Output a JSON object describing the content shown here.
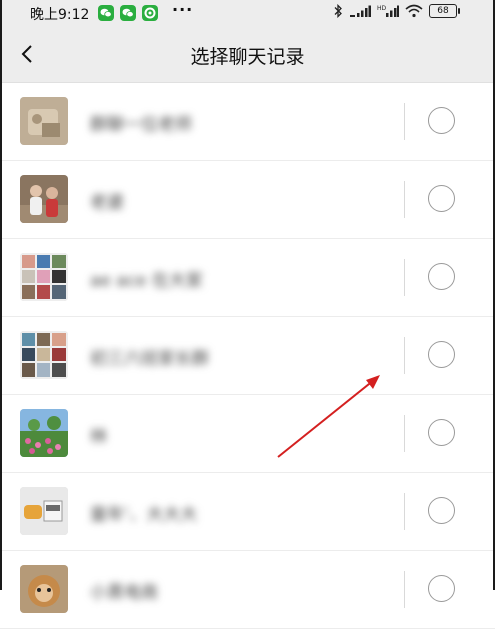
{
  "status_bar": {
    "time": "晚上9:12",
    "more": "···",
    "battery": "68"
  },
  "header": {
    "title": "选择聊天记录",
    "back_icon": "chevron-left-icon"
  },
  "chats": [
    {
      "name": "群聊一位老师",
      "selected": false
    },
    {
      "name": "老婆",
      "selected": false
    },
    {
      "name": "ae ace 在大家",
      "selected": false
    },
    {
      "name": "初三六班家长群",
      "selected": false
    },
    {
      "name": "林",
      "selected": false
    },
    {
      "name": "童年‘、大大大",
      "selected": false
    },
    {
      "name": "小黑电商",
      "selected": false
    }
  ],
  "colors": {
    "header_bg": "#ededed",
    "list_bg": "#ffffff",
    "wechat_green": "#2aae3f",
    "annotation_red": "#d42020"
  }
}
